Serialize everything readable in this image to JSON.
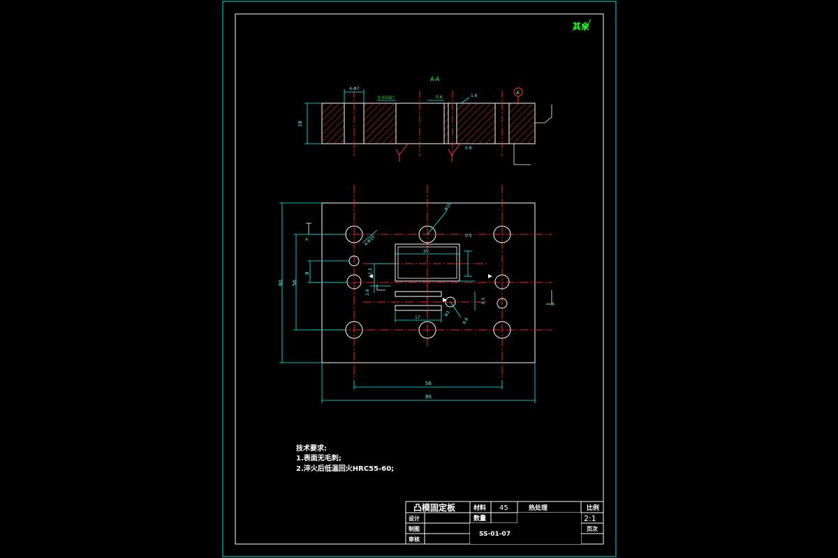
{
  "colors": {
    "background": "#000000",
    "frame": "#00ffff",
    "outline": "#ffffff",
    "centerline": "#ff2222",
    "hatch": "#ff3333",
    "dimension": "#00ffff",
    "annotation": "#22ff22"
  },
  "header": {
    "corner_mark": "其余"
  },
  "section": {
    "label": "A-A",
    "dims": {
      "top_left": "4-Φ7",
      "top_fit": "0.0156°",
      "top_mid": "0.6",
      "top_small": "1.6",
      "height": "18"
    },
    "roughness_mark": "0.8"
  },
  "plan": {
    "section_marker": "A",
    "dims": {
      "outer_height": "80",
      "inner_height": "56",
      "hole_offset": "8",
      "outer_width": "80",
      "hole_spacing": "56",
      "rect_width": "20",
      "slot_len": "17",
      "v1": "2.3",
      "v2": "2.8",
      "v3": "6.5",
      "small_r": "8.8"
    },
    "notes": [
      "Φ10",
      "4-Φ10",
      "0.5",
      "Φ3"
    ]
  },
  "tech_requirements": {
    "title": "技术要求:",
    "items": [
      "1.表面无毛刺;",
      "2.淬火后低温回火HRC55-60;"
    ]
  },
  "title_block": {
    "part_name": "凸模固定板",
    "material_label": "材料",
    "material_value": "45",
    "heat_treatment_label": "热处理",
    "scale_label": "比例",
    "scale_value": "2:1",
    "designer_label": "设计",
    "quantity_label": "数量",
    "drafter_label": "制图",
    "drawing_no": "SS-01-07",
    "sheet_label": "页次",
    "reviewer_label": "审核"
  }
}
